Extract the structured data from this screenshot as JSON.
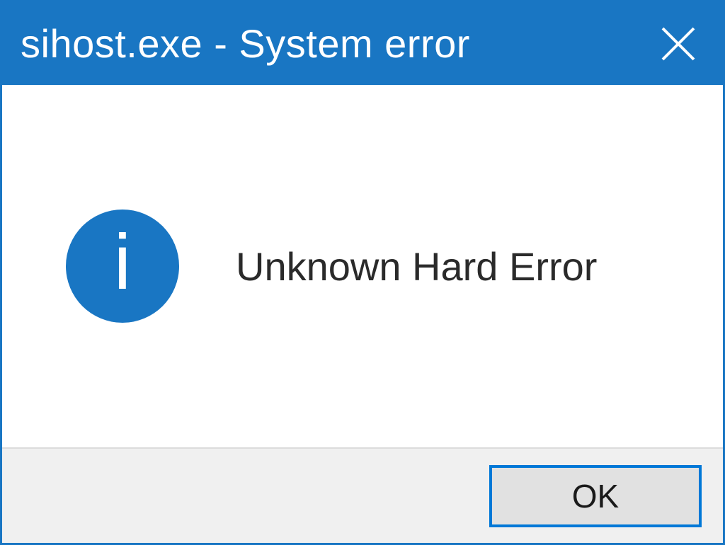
{
  "dialog": {
    "title": "sihost.exe - System error",
    "message": "Unknown Hard Error",
    "ok_label": "OK"
  },
  "icons": {
    "info_glyph": "i"
  },
  "colors": {
    "accent": "#1976c3",
    "button_border": "#0078d7",
    "footer_bg": "#f0f0f0"
  }
}
